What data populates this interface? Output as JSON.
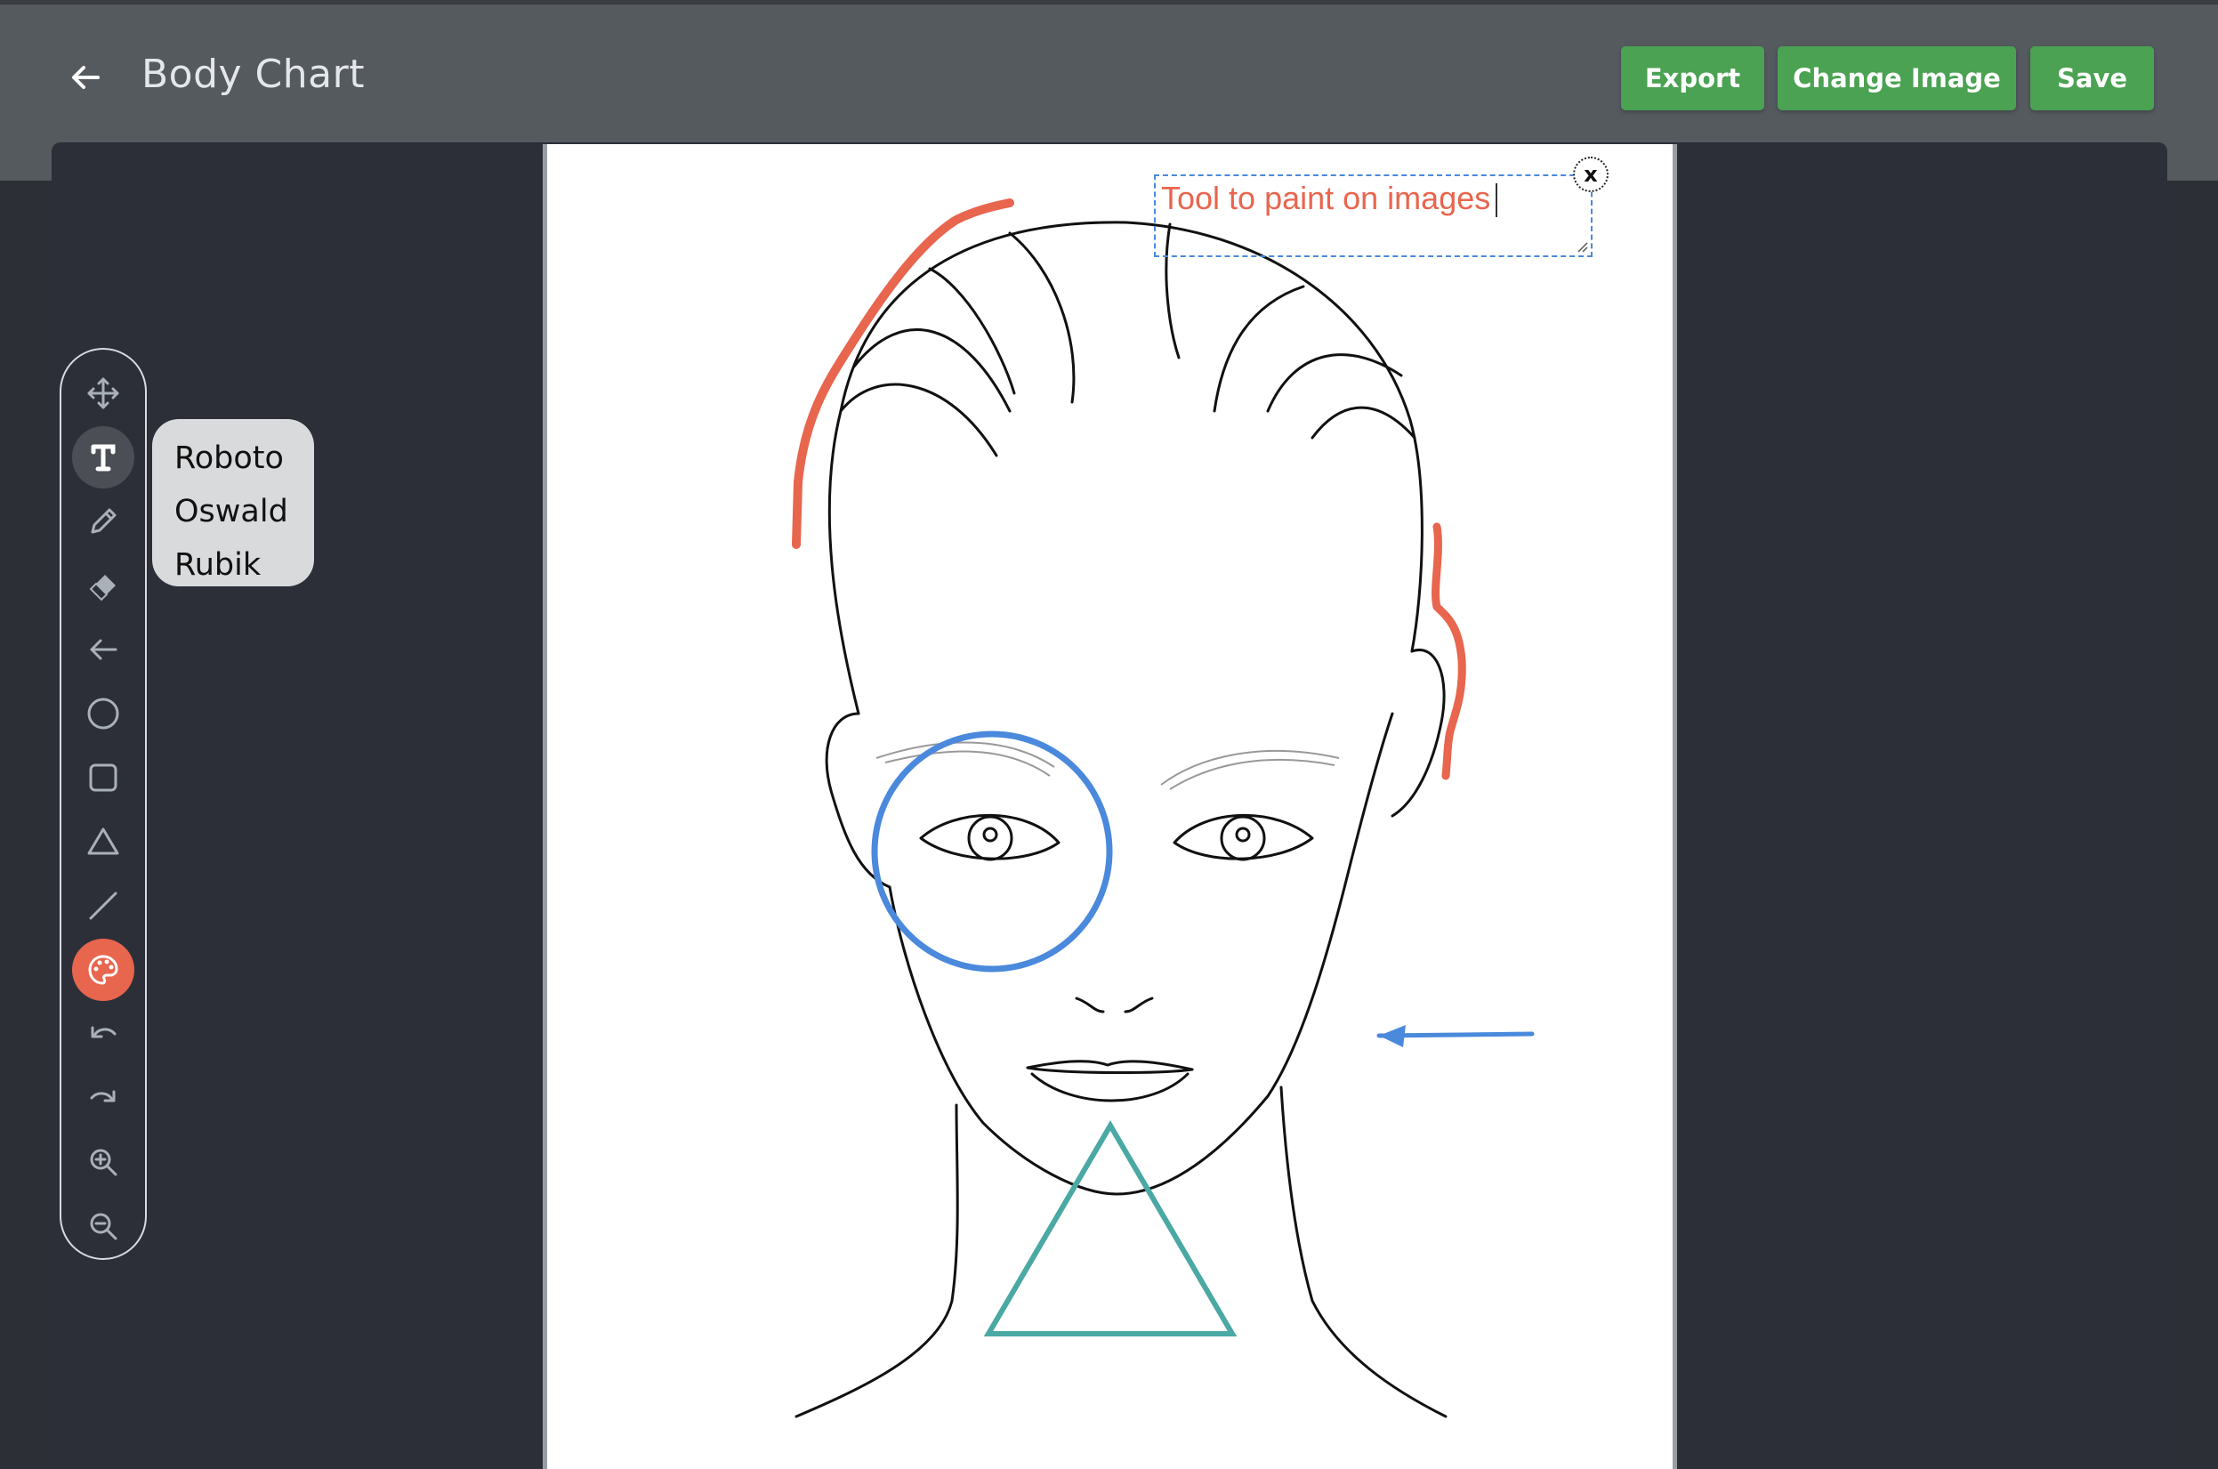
{
  "header": {
    "back_icon": "arrow-left-icon",
    "title": "Body Chart",
    "buttons": {
      "export": "Export",
      "change_image": "Change Image",
      "save": "Save"
    }
  },
  "colors": {
    "header_bg": "#555a5f",
    "panel_bg": "#2c2f38",
    "button_green": "#4aa252",
    "accent_red": "#e8654e",
    "circle_blue": "#4a89dc",
    "triangle_teal": "#4aa9a4"
  },
  "toolbar": {
    "tools": [
      {
        "name": "move",
        "icon": "move-icon",
        "state": "idle"
      },
      {
        "name": "text",
        "icon": "text-icon",
        "state": "selected"
      },
      {
        "name": "pencil",
        "icon": "pencil-icon",
        "state": "idle"
      },
      {
        "name": "eraser",
        "icon": "eraser-icon",
        "state": "idle"
      },
      {
        "name": "arrow",
        "icon": "arrow-left-icon",
        "state": "idle"
      },
      {
        "name": "circle",
        "icon": "circle-icon",
        "state": "idle"
      },
      {
        "name": "rectangle",
        "icon": "square-icon",
        "state": "idle"
      },
      {
        "name": "triangle",
        "icon": "triangle-icon",
        "state": "idle"
      },
      {
        "name": "line",
        "icon": "line-icon",
        "state": "idle"
      },
      {
        "name": "color",
        "icon": "palette-icon",
        "state": "active"
      },
      {
        "name": "undo",
        "icon": "undo-icon",
        "state": "idle"
      },
      {
        "name": "redo",
        "icon": "redo-icon",
        "state": "idle"
      },
      {
        "name": "zoom-in",
        "icon": "zoom-in-icon",
        "state": "idle"
      },
      {
        "name": "zoom-out",
        "icon": "zoom-out-icon",
        "state": "idle"
      }
    ]
  },
  "font_menu": {
    "options": [
      "Roboto",
      "Oswald",
      "Rubik"
    ]
  },
  "canvas": {
    "image": "face-line-drawing",
    "annotation_text": "Tool to paint on images",
    "close_label": "x"
  }
}
